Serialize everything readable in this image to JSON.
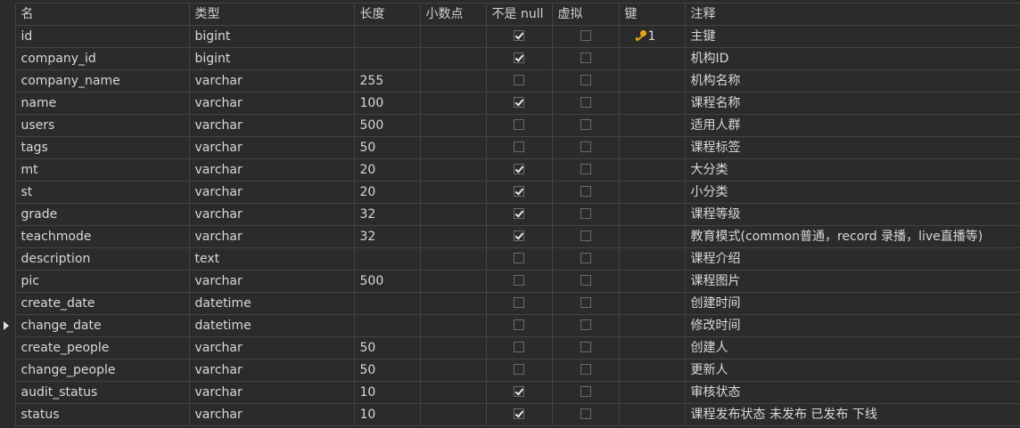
{
  "columns": {
    "name": "名",
    "type": "类型",
    "length": "长度",
    "decimals": "小数点",
    "not_null": "不是 null",
    "virtual": "虚拟",
    "key": "键",
    "comment": "注释"
  },
  "colors": {
    "background": "#2b2b2b",
    "grid_line": "#444444",
    "text": "#d8d8d8",
    "key_icon": "#e6a817"
  },
  "current_row": 13,
  "rows": [
    {
      "name": "id",
      "type": "bigint",
      "length": "",
      "decimals": "",
      "not_null": true,
      "virtual": false,
      "key": "1",
      "comment": "主键"
    },
    {
      "name": "company_id",
      "type": "bigint",
      "length": "",
      "decimals": "",
      "not_null": true,
      "virtual": false,
      "key": "",
      "comment": "机构ID"
    },
    {
      "name": "company_name",
      "type": "varchar",
      "length": "255",
      "decimals": "",
      "not_null": false,
      "virtual": false,
      "key": "",
      "comment": "机构名称"
    },
    {
      "name": "name",
      "type": "varchar",
      "length": "100",
      "decimals": "",
      "not_null": true,
      "virtual": false,
      "key": "",
      "comment": "课程名称"
    },
    {
      "name": "users",
      "type": "varchar",
      "length": "500",
      "decimals": "",
      "not_null": false,
      "virtual": false,
      "key": "",
      "comment": "适用人群"
    },
    {
      "name": "tags",
      "type": "varchar",
      "length": "50",
      "decimals": "",
      "not_null": false,
      "virtual": false,
      "key": "",
      "comment": "课程标签"
    },
    {
      "name": "mt",
      "type": "varchar",
      "length": "20",
      "decimals": "",
      "not_null": true,
      "virtual": false,
      "key": "",
      "comment": "大分类"
    },
    {
      "name": "st",
      "type": "varchar",
      "length": "20",
      "decimals": "",
      "not_null": true,
      "virtual": false,
      "key": "",
      "comment": "小分类"
    },
    {
      "name": "grade",
      "type": "varchar",
      "length": "32",
      "decimals": "",
      "not_null": true,
      "virtual": false,
      "key": "",
      "comment": "课程等级"
    },
    {
      "name": "teachmode",
      "type": "varchar",
      "length": "32",
      "decimals": "",
      "not_null": true,
      "virtual": false,
      "key": "",
      "comment": "教育模式(common普通，record 录播，live直播等)"
    },
    {
      "name": "description",
      "type": "text",
      "length": "",
      "decimals": "",
      "not_null": false,
      "virtual": false,
      "key": "",
      "comment": "课程介绍"
    },
    {
      "name": "pic",
      "type": "varchar",
      "length": "500",
      "decimals": "",
      "not_null": false,
      "virtual": false,
      "key": "",
      "comment": "课程图片"
    },
    {
      "name": "create_date",
      "type": "datetime",
      "length": "",
      "decimals": "",
      "not_null": false,
      "virtual": false,
      "key": "",
      "comment": "创建时间"
    },
    {
      "name": "change_date",
      "type": "datetime",
      "length": "",
      "decimals": "",
      "not_null": false,
      "virtual": false,
      "key": "",
      "comment": "修改时间"
    },
    {
      "name": "create_people",
      "type": "varchar",
      "length": "50",
      "decimals": "",
      "not_null": false,
      "virtual": false,
      "key": "",
      "comment": "创建人"
    },
    {
      "name": "change_people",
      "type": "varchar",
      "length": "50",
      "decimals": "",
      "not_null": false,
      "virtual": false,
      "key": "",
      "comment": "更新人"
    },
    {
      "name": "audit_status",
      "type": "varchar",
      "length": "10",
      "decimals": "",
      "not_null": true,
      "virtual": false,
      "key": "",
      "comment": "审核状态"
    },
    {
      "name": "status",
      "type": "varchar",
      "length": "10",
      "decimals": "",
      "not_null": true,
      "virtual": false,
      "key": "",
      "comment": "课程发布状态 未发布  已发布 下线"
    }
  ]
}
